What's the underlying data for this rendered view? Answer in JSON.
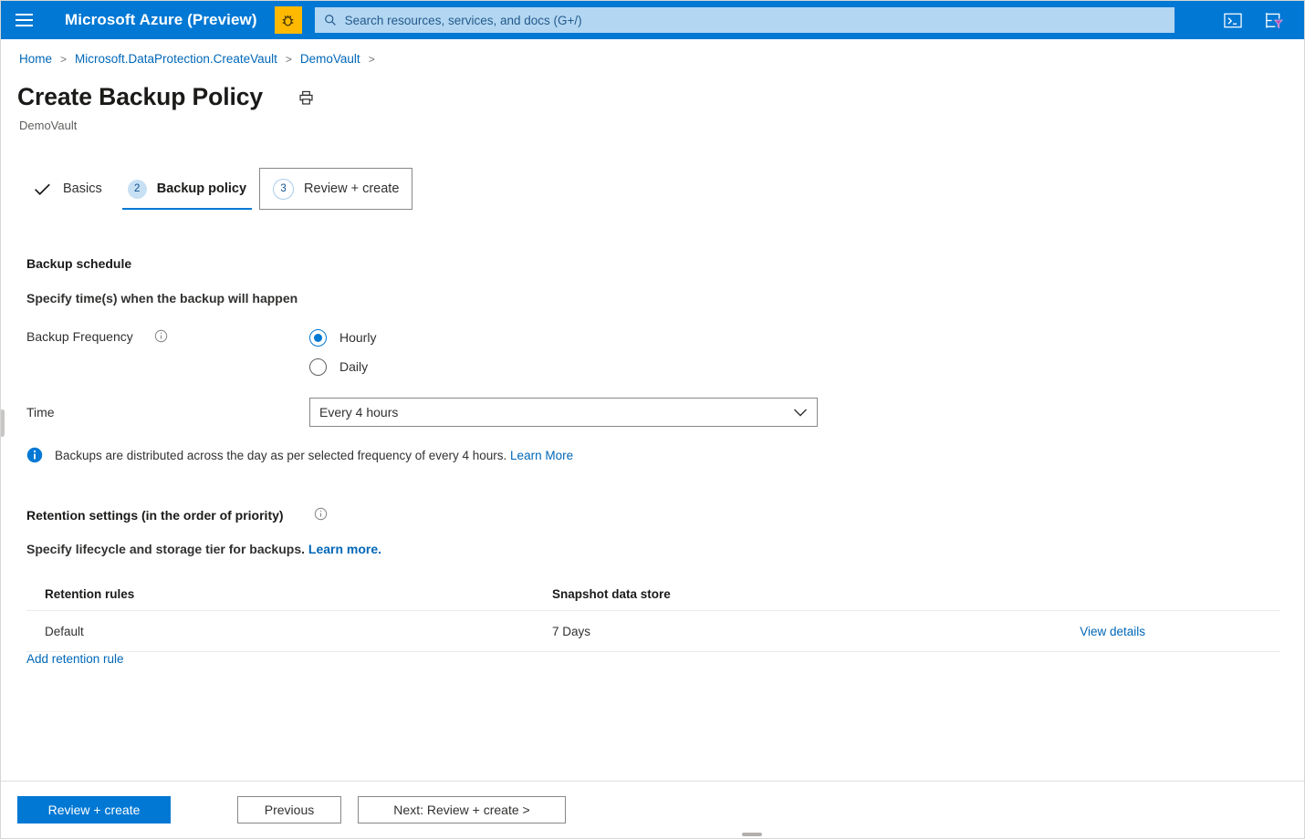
{
  "topbar": {
    "menu_icon": "hamburger-icon",
    "brand": "Microsoft Azure (Preview)",
    "bug_icon": "bug-icon",
    "search": {
      "icon": "search-icon",
      "placeholder": "Search resources, services, and docs (G+/)"
    },
    "icons": [
      {
        "name": "cloud-shell-icon"
      },
      {
        "name": "directory-filter-icon"
      }
    ],
    "background": "#0078d4",
    "bug_background": "#ffb900",
    "search_background": "#b3d7f2"
  },
  "breadcrumb": {
    "items": [
      "Home",
      "Microsoft.DataProtection.CreateVault",
      "DemoVault"
    ],
    "separator": ">",
    "trailing_separator": ">"
  },
  "header": {
    "title": "Create Backup Policy",
    "print_icon": "print-icon",
    "subtitle": "DemoVault"
  },
  "wizard": {
    "tabs": [
      {
        "label": "Basics",
        "state": "done",
        "marker": "check-icon"
      },
      {
        "label": "Backup policy",
        "state": "active",
        "marker": "2"
      },
      {
        "label": "Review + create",
        "state": "upcoming",
        "marker": "3"
      }
    ]
  },
  "schedule": {
    "heading": "Backup schedule",
    "description": "Specify time(s) when the backup will happen",
    "frequency_label": "Backup Frequency",
    "frequency_info_icon": "info-circle-icon",
    "frequency_options": [
      {
        "label": "Hourly",
        "selected": true
      },
      {
        "label": "Daily",
        "selected": false
      }
    ],
    "time_label": "Time",
    "time_value": "Every 4 hours",
    "time_chevron": "chevron-down-icon",
    "info": {
      "icon": "info-filled-icon",
      "text": "Backups are distributed across the day as per selected frequency of every 4 hours.",
      "link": "Learn More"
    }
  },
  "retention": {
    "heading": "Retention settings (in the order of priority)",
    "heading_info_icon": "info-circle-icon",
    "subtext": "Specify lifecycle and storage tier for backups.",
    "subtext_link": "Learn more.",
    "columns": [
      "Retention rules",
      "Snapshot data store",
      ""
    ],
    "rows": [
      {
        "rule": "Default",
        "snapshot_data_store": "7 Days",
        "action": "View details"
      }
    ],
    "add_rule_link": "Add retention rule"
  },
  "footer": {
    "primary_button": "Review + create",
    "previous_button": "Previous",
    "next_button": "Next: Review + create >"
  },
  "colors": {
    "azure_blue": "#0078d4",
    "link_blue": "#0067b8",
    "accent_amber": "#ffb900",
    "text_primary": "#323130",
    "text_secondary": "#605e5c"
  }
}
